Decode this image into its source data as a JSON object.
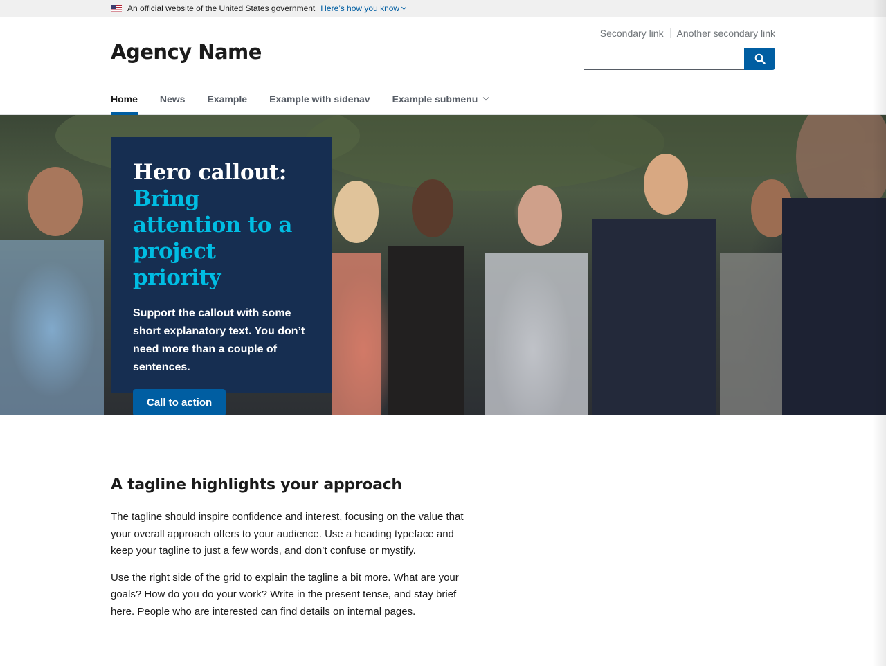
{
  "gov_banner": {
    "text": "An official website of the United States government",
    "link_label": "Here’s how you know"
  },
  "header": {
    "agency_name": "Agency Name",
    "secondary_links": [
      "Secondary link",
      "Another secondary link"
    ],
    "search": {
      "value": "",
      "button_icon": "search-icon"
    }
  },
  "nav": {
    "items": [
      {
        "label": "Home",
        "active": true
      },
      {
        "label": "News"
      },
      {
        "label": "Example"
      },
      {
        "label": "Example with sidenav"
      },
      {
        "label": "Example submenu",
        "has_submenu": true
      }
    ]
  },
  "hero": {
    "heading_lead": "Hero callout:",
    "heading_accent": "Bring attention to a project priority",
    "text": "Support the callout with some short explanatory text. You don’t need more than a couple of sentences.",
    "cta_label": "Call to action",
    "colors": {
      "callout_bg": "#162e51",
      "accent": "#00bde3",
      "button": "#005ea2"
    }
  },
  "tagline": {
    "heading": "A tagline highlights your approach",
    "paragraphs": [
      "The tagline should inspire confidence and interest, focusing on the value that your overall approach offers to your audience. Use a heading typeface and keep your tagline to just a few words, and don’t confuse or mystify.",
      "Use the right side of the grid to explain the tagline a bit more. What are your goals? How do you do your work? Write in the present tense, and stay brief here. People who are interested can find details on internal pages."
    ]
  }
}
